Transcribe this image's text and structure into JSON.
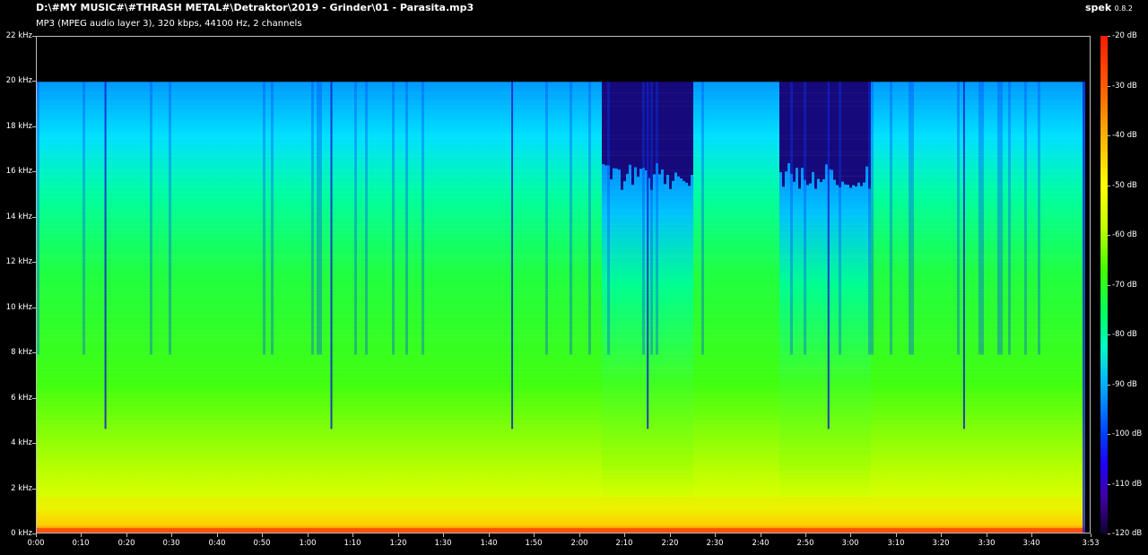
{
  "header": {
    "file_path": "D:\\#MY MUSIC#\\#THRASH METAL#\\Detraktor\\2019 - Grinder\\01 - Parasita.mp3",
    "file_info": "MP3 (MPEG audio layer 3), 320 kbps, 44100 Hz, 2 channels",
    "app_name": "spek",
    "app_version": "0.8.2"
  },
  "freq_axis": {
    "ticks": [
      "0 kHz",
      "2 kHz",
      "4 kHz",
      "6 kHz",
      "8 kHz",
      "10 kHz",
      "12 kHz",
      "14 kHz",
      "16 kHz",
      "18 kHz",
      "20 kHz",
      "22 kHz"
    ],
    "max_khz": 22
  },
  "time_axis": {
    "ticks": [
      "0:00",
      "0:10",
      "0:20",
      "0:30",
      "0:40",
      "0:50",
      "1:00",
      "1:10",
      "1:20",
      "1:30",
      "1:40",
      "1:50",
      "2:00",
      "2:10",
      "2:20",
      "2:30",
      "2:40",
      "2:50",
      "3:00",
      "3:10",
      "3:20",
      "3:30",
      "3:40",
      "3:53"
    ],
    "duration_seconds": 233
  },
  "db_scale": {
    "ticks": [
      "-20 dB",
      "-30 dB",
      "-40 dB",
      "-50 dB",
      "-60 dB",
      "-70 dB",
      "-80 dB",
      "-90 dB",
      "-100 dB",
      "-110 dB",
      "-120 dB"
    ],
    "max_db": -20,
    "min_db": -120
  },
  "spectrogram": {
    "cutoff_khz": 20,
    "quiet_sections_seconds": [
      [
        125,
        145
      ],
      [
        164,
        184
      ]
    ],
    "quiet_cutoff_khz": 16,
    "gaps_seconds": [
      15,
      65,
      105,
      135,
      175,
      205
    ]
  }
}
